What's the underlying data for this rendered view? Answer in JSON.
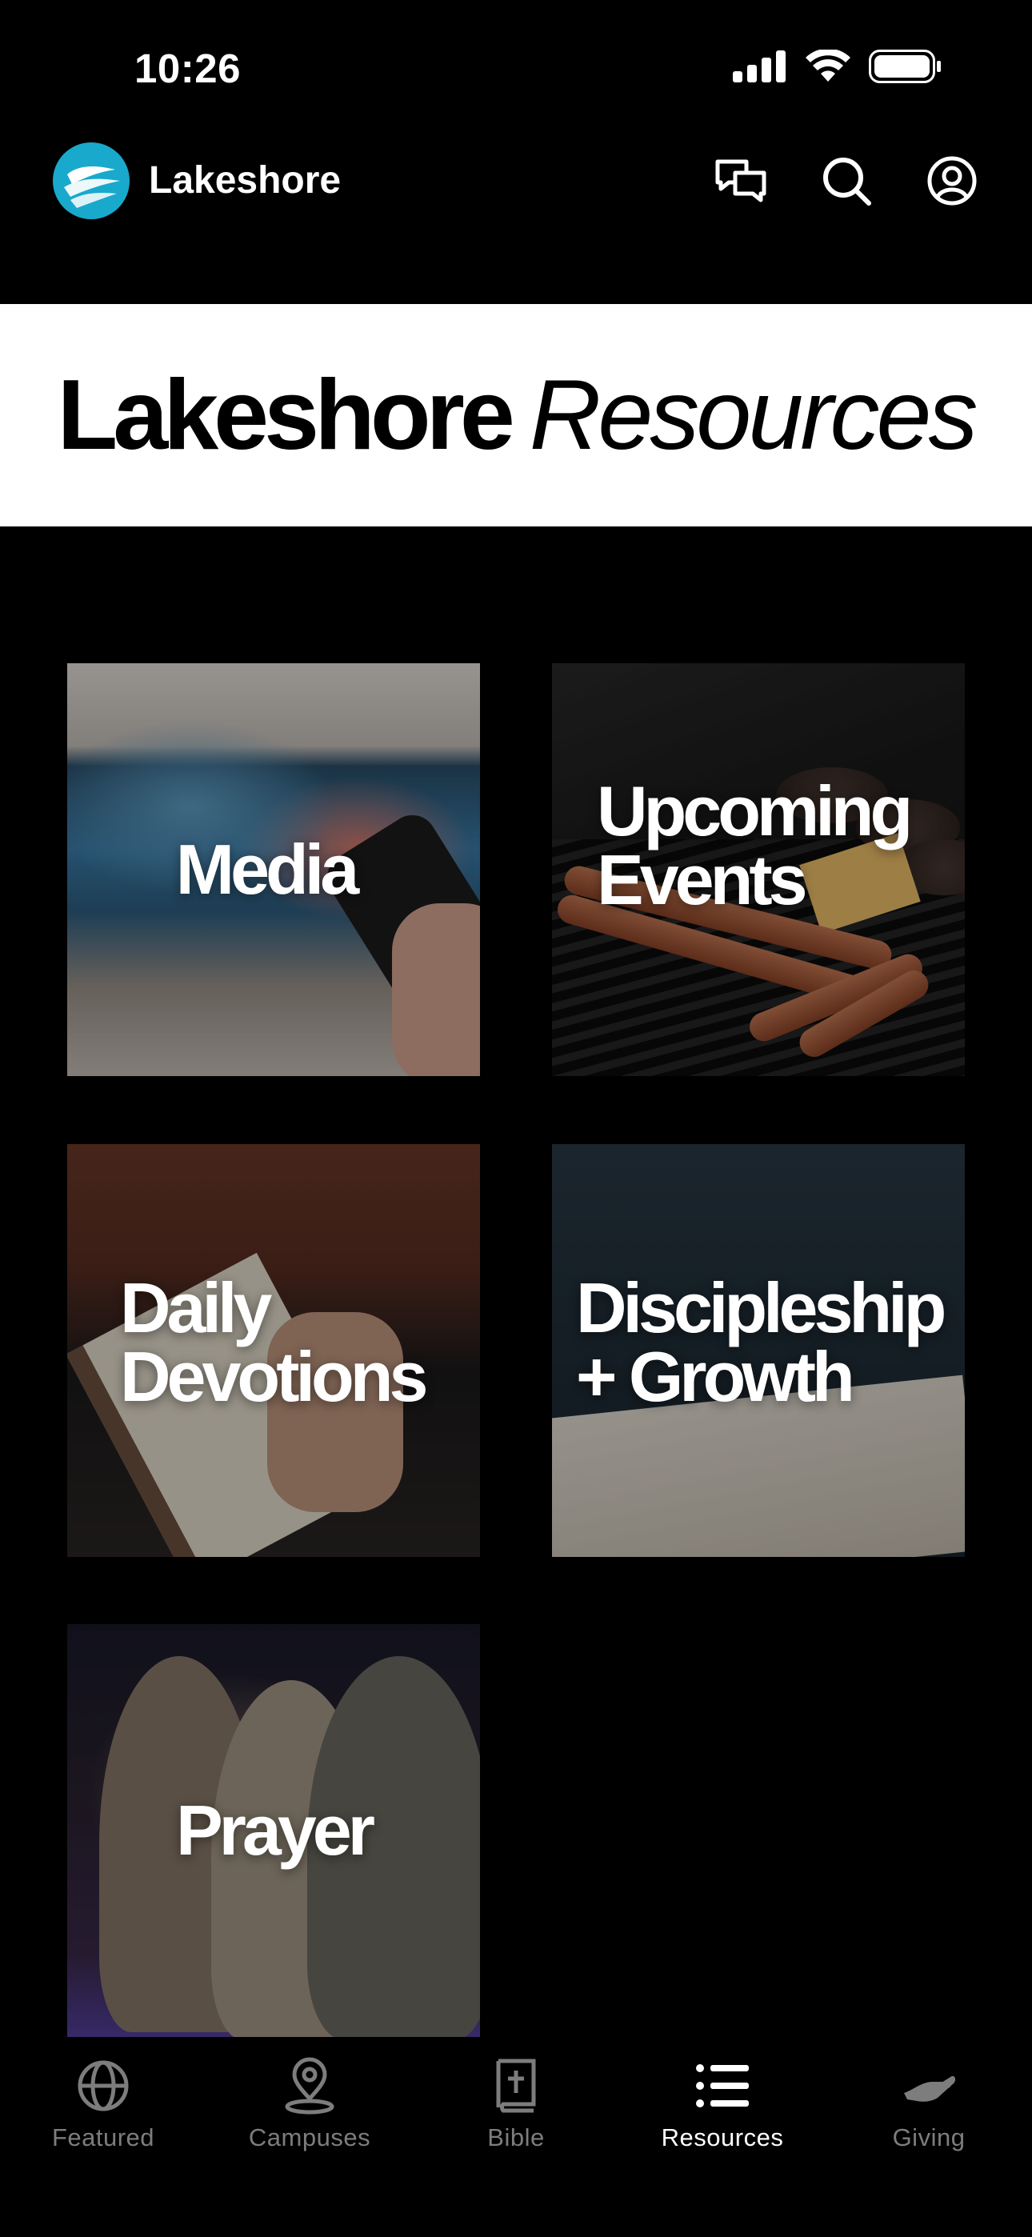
{
  "status_bar": {
    "time": "10:26"
  },
  "header": {
    "app_name": "Lakeshore"
  },
  "banner": {
    "title_bold": "Lakeshore",
    "title_light": "Resources"
  },
  "tiles": [
    {
      "label_lines": [
        "Media"
      ]
    },
    {
      "label_lines": [
        "Upcoming",
        "Events"
      ]
    },
    {
      "label_lines": [
        "Daily",
        "Devotions"
      ]
    },
    {
      "label_lines": [
        "Discipleship",
        "+ Growth"
      ]
    },
    {
      "label_lines": [
        "Prayer"
      ]
    }
  ],
  "tab_bar": {
    "items": [
      {
        "label": "Featured",
        "icon": "globe-icon",
        "active": false
      },
      {
        "label": "Campuses",
        "icon": "map-pin-icon",
        "active": false
      },
      {
        "label": "Bible",
        "icon": "bible-icon",
        "active": false
      },
      {
        "label": "Resources",
        "icon": "list-icon",
        "active": true
      },
      {
        "label": "Giving",
        "icon": "giving-hand-icon",
        "active": false
      }
    ]
  },
  "colors": {
    "brand": "#19a9cc",
    "inactive_tab": "#7d7d7d",
    "active_tab": "#ffffff"
  }
}
